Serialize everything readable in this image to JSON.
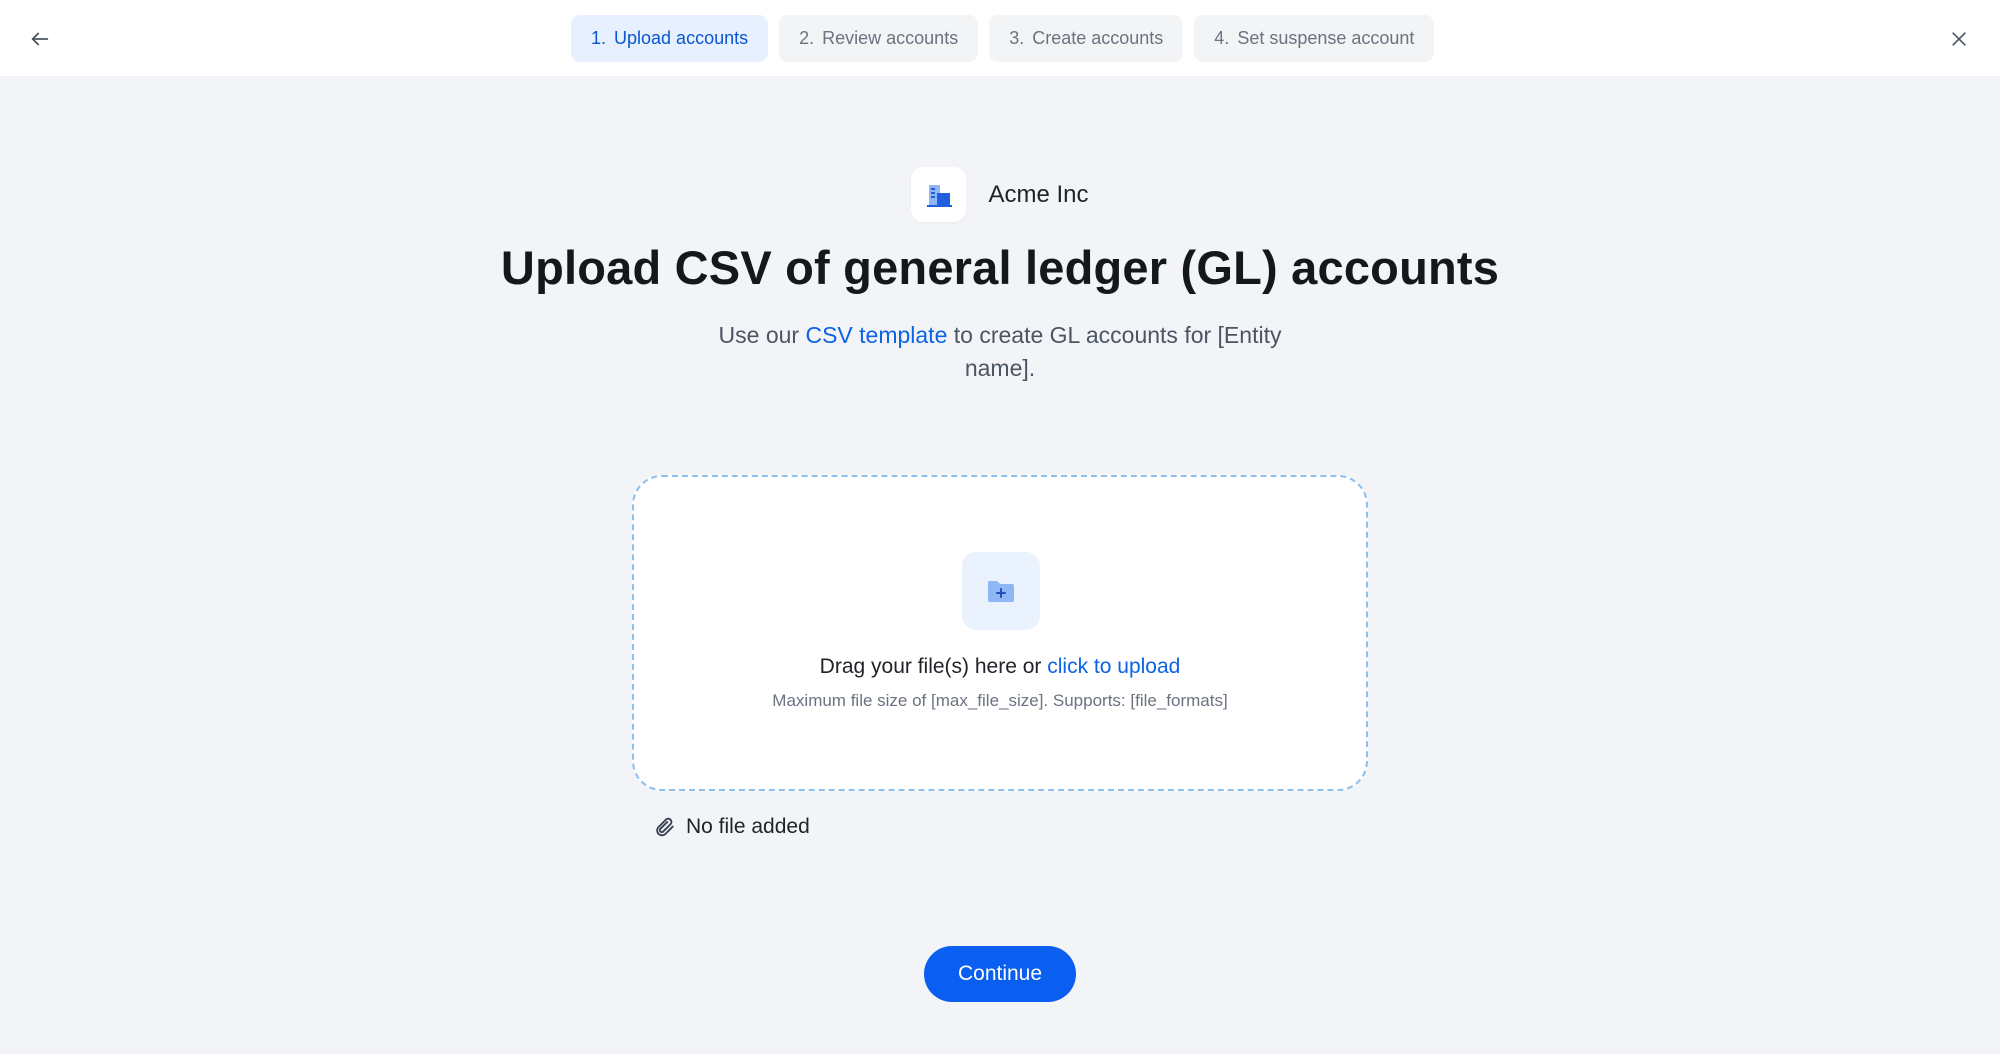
{
  "header": {
    "back_icon": "arrow-left-icon",
    "close_icon": "close-icon",
    "steps": [
      {
        "number": "1.",
        "label": "Upload accounts",
        "active": true
      },
      {
        "number": "2.",
        "label": "Review accounts",
        "active": false
      },
      {
        "number": "3.",
        "label": "Create accounts",
        "active": false
      },
      {
        "number": "4.",
        "label": "Set suspense account",
        "active": false
      }
    ]
  },
  "entity": {
    "name": "Acme Inc",
    "logo_icon": "building-icon"
  },
  "page": {
    "title": "Upload CSV of general ledger (GL) accounts",
    "subtitle_prefix": "Use our ",
    "subtitle_link": "CSV template",
    "subtitle_suffix": " to create GL accounts for [Entity name]."
  },
  "dropzone": {
    "icon": "folder-plus-icon",
    "text_prefix": "Drag your file(s) here or ",
    "text_link": "click to upload",
    "hint": "Maximum file size of [max_file_size]. Supports: [file_formats]"
  },
  "file_status": {
    "icon": "paperclip-icon",
    "text": "No file added"
  },
  "actions": {
    "continue_label": "Continue"
  },
  "colors": {
    "accent": "#0a5ef0",
    "link": "#0b63e5",
    "active_step_bg": "#e6f0ff",
    "background": "#f3f4f7",
    "dropzone_border": "#8cc0ee"
  }
}
